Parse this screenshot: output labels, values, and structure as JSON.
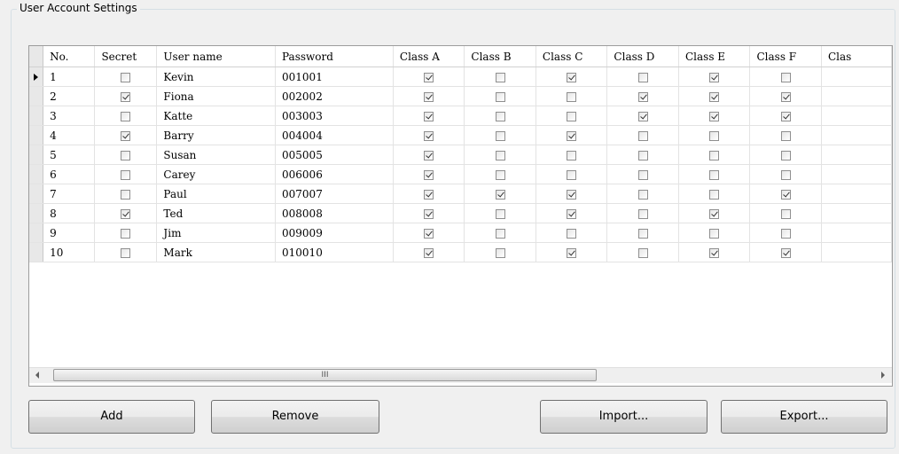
{
  "group": {
    "title": "User Account Settings"
  },
  "grid": {
    "columns": [
      "No.",
      "Secret",
      "User name",
      "Password",
      "Class A",
      "Class B",
      "Class C",
      "Class D",
      "Class E",
      "Class F",
      "Clas"
    ],
    "current_row": 0,
    "rows": [
      {
        "no": "1",
        "secret": false,
        "username": "Kevin",
        "password": "001001",
        "classes": [
          true,
          false,
          true,
          false,
          true,
          false
        ]
      },
      {
        "no": "2",
        "secret": true,
        "username": "Fiona",
        "password": "002002",
        "classes": [
          true,
          false,
          false,
          true,
          true,
          true
        ]
      },
      {
        "no": "3",
        "secret": false,
        "username": "Katte",
        "password": "003003",
        "classes": [
          true,
          false,
          false,
          true,
          true,
          true
        ]
      },
      {
        "no": "4",
        "secret": true,
        "username": "Barry",
        "password": "004004",
        "classes": [
          true,
          false,
          true,
          false,
          false,
          false
        ]
      },
      {
        "no": "5",
        "secret": false,
        "username": "Susan",
        "password": "005005",
        "classes": [
          true,
          false,
          false,
          false,
          false,
          false
        ]
      },
      {
        "no": "6",
        "secret": false,
        "username": "Carey",
        "password": "006006",
        "classes": [
          true,
          false,
          false,
          false,
          false,
          false
        ]
      },
      {
        "no": "7",
        "secret": false,
        "username": "Paul",
        "password": "007007",
        "classes": [
          true,
          true,
          true,
          false,
          false,
          true
        ]
      },
      {
        "no": "8",
        "secret": true,
        "username": "Ted",
        "password": "008008",
        "classes": [
          true,
          false,
          true,
          false,
          true,
          false
        ]
      },
      {
        "no": "9",
        "secret": false,
        "username": "Jim",
        "password": "009009",
        "classes": [
          true,
          false,
          false,
          false,
          false,
          false
        ]
      },
      {
        "no": "10",
        "secret": false,
        "username": "Mark",
        "password": "010010",
        "classes": [
          true,
          false,
          true,
          false,
          true,
          true
        ]
      }
    ]
  },
  "scrollbar": {
    "thumb_grip": "III",
    "left_icon": "scroll-left-arrow",
    "right_icon": "scroll-right-arrow"
  },
  "buttons": {
    "add": "Add",
    "remove": "Remove",
    "import": "Import...",
    "export": "Export..."
  }
}
